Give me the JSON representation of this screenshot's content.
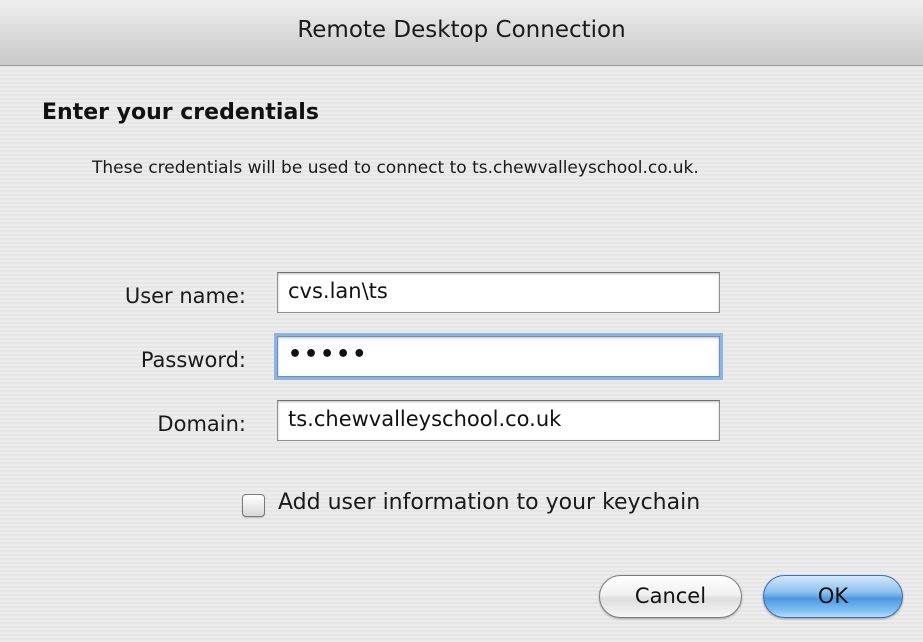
{
  "window": {
    "title": "Remote Desktop Connection"
  },
  "dialog": {
    "heading": "Enter your credentials",
    "subtitle": "These credentials will be used to connect to ts.chewvalleyschool.co.uk."
  },
  "form": {
    "username_label": "User name:",
    "username_value": "cvs.lan\\ts",
    "password_label": "Password:",
    "password_value": "•••••",
    "domain_label": "Domain:",
    "domain_value": "ts.chewvalleyschool.co.uk",
    "keychain_label": "Add user information to your keychain",
    "keychain_checked": false
  },
  "buttons": {
    "cancel_label": "Cancel",
    "ok_label": "OK"
  },
  "colors": {
    "focus_ring": "#8fb3e0",
    "default_button": "#4f97e2"
  }
}
